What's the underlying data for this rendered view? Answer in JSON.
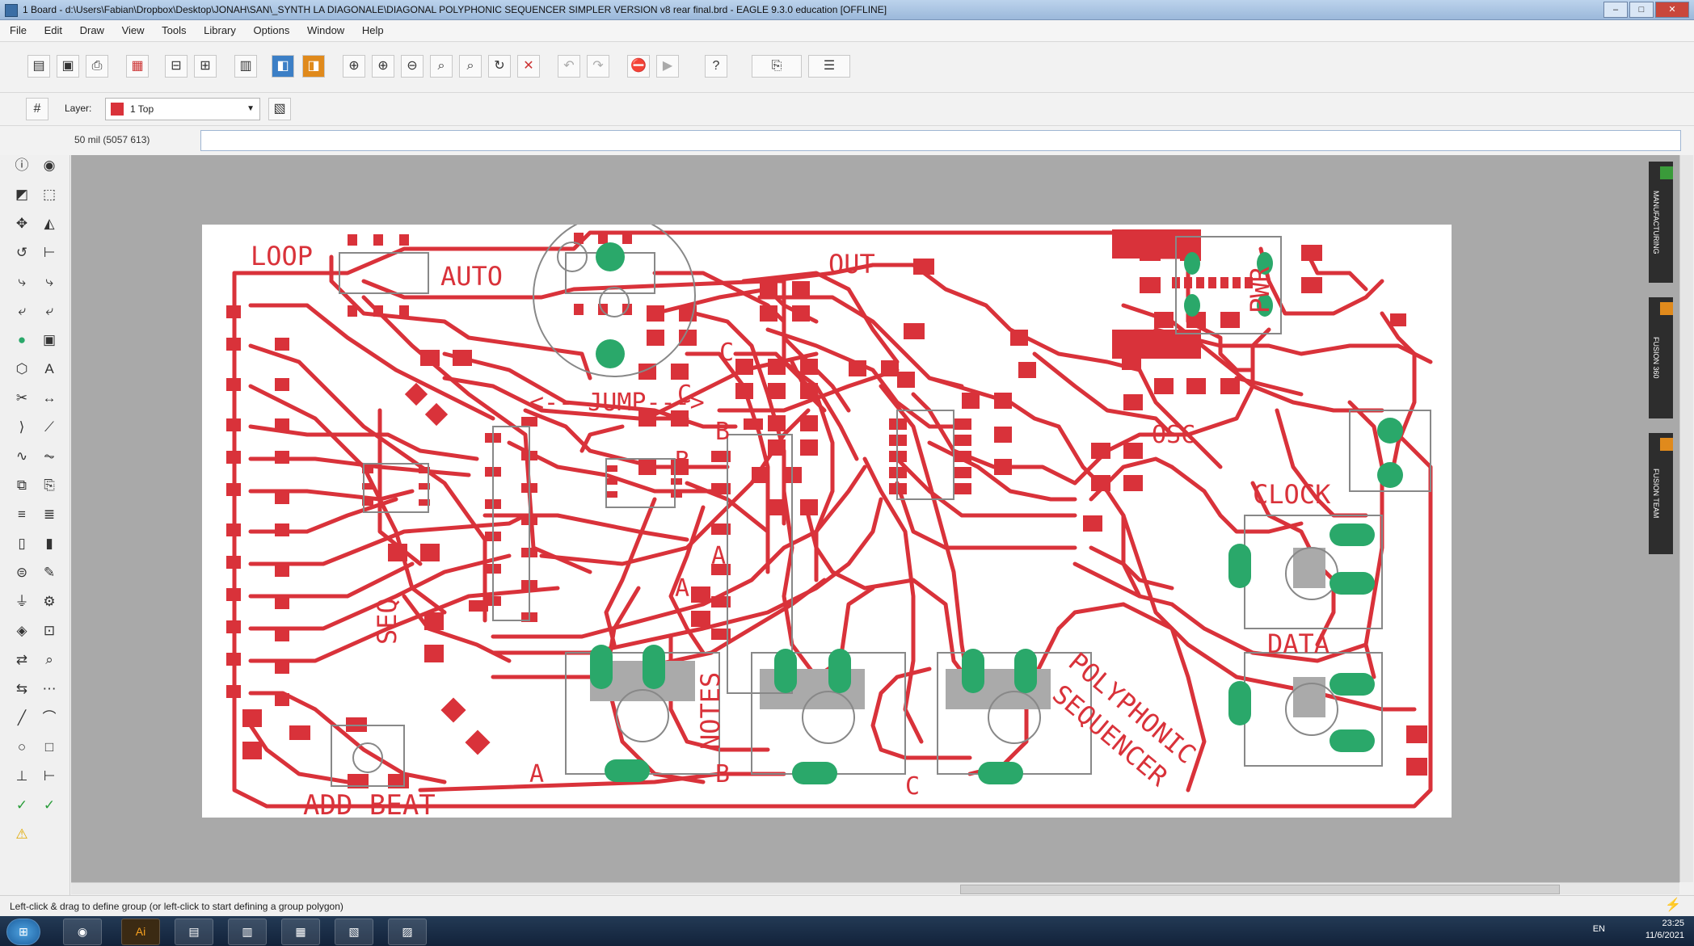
{
  "window": {
    "title": "1 Board - d:\\Users\\Fabian\\Dropbox\\Desktop\\JONAH\\SAN\\_SYNTH LA DIAGONALE\\DIAGONAL POLYPHONIC SEQUENCER SIMPLER VERSION v8 rear final.brd - EAGLE 9.3.0 education [OFFLINE]"
  },
  "menu": [
    "File",
    "Edit",
    "Draw",
    "View",
    "Tools",
    "Library",
    "Options",
    "Window",
    "Help"
  ],
  "layer": {
    "label": "Layer:",
    "selected": "1 Top",
    "color": "#d9323a"
  },
  "coordinates": "50 mil (5057 613)",
  "status_message": "Left-click & drag to define group (or left-click to start defining a group polygon)",
  "right_dock": [
    "MANUFACTURING",
    "FUSION 360",
    "FUSION TEAM"
  ],
  "board": {
    "trace_color": "#d9323a",
    "pad_color": "#2aa86a",
    "silk_labels": [
      "LOOP",
      "AUTO",
      "OUT",
      "PWR",
      "<---JUMP--->",
      "OSC",
      "CLOCK",
      "DATA",
      "SEQ",
      "NOTES",
      "ADD BEAT",
      "POLYPHONIC",
      "SEQUENCER",
      "A",
      "A",
      "A",
      "B",
      "B",
      "B",
      "C",
      "C",
      "C"
    ]
  },
  "taskbar": {
    "time": "23:25",
    "date": "11/6/2021",
    "lang": "EN"
  }
}
